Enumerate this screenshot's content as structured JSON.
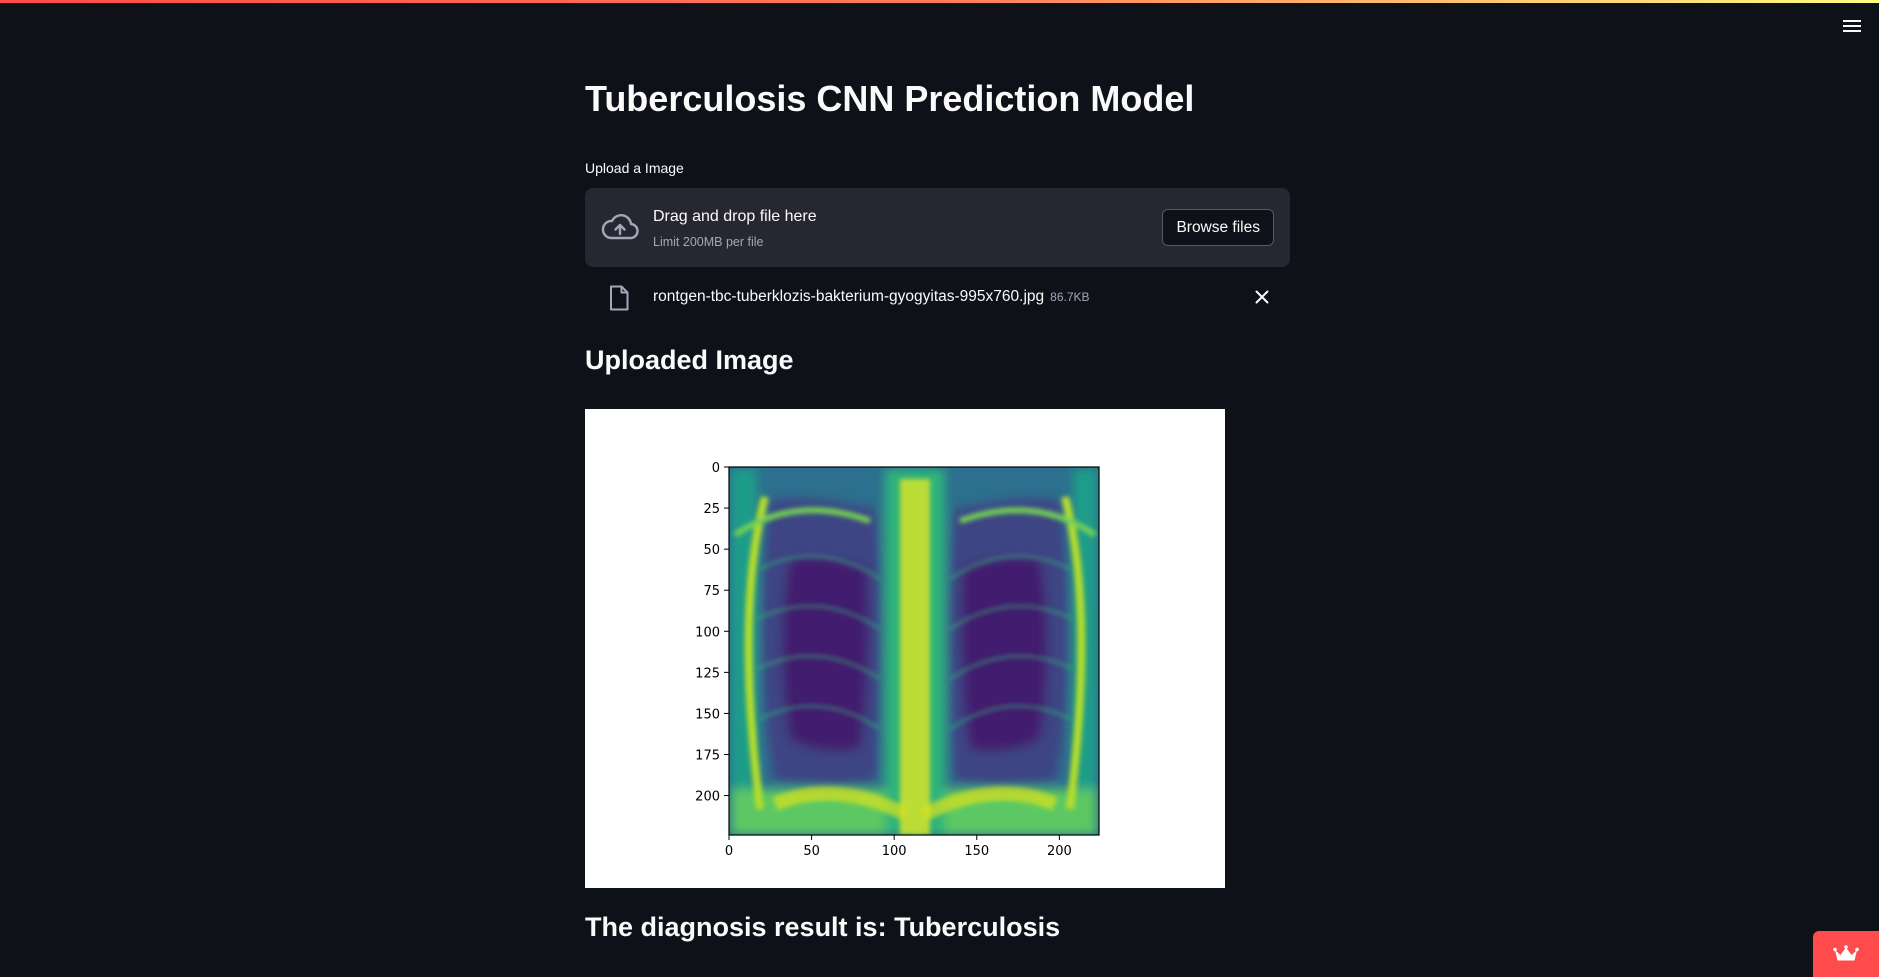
{
  "app": {
    "title": "Tuberculosis CNN Prediction Model",
    "icons": {
      "menu": "hamburger-menu-icon",
      "deploy": "crown-icon"
    }
  },
  "uploader": {
    "label": "Upload a Image",
    "dropzone_title": "Drag and drop file here",
    "dropzone_limit": "Limit 200MB per file",
    "browse_label": "Browse files",
    "icons": {
      "upload": "cloud-upload-icon",
      "file": "file-icon",
      "remove": "close-icon"
    },
    "file": {
      "name": "rontgen-tbc-tuberklozis-bakterium-gyogyitas-995x760.jpg",
      "size": "86.7KB"
    }
  },
  "section_uploaded": {
    "heading": "Uploaded Image"
  },
  "chart_data": {
    "type": "heatmap",
    "title": "",
    "xlabel": "",
    "ylabel": "",
    "image_size": [
      224,
      224
    ],
    "colormap": "viridis",
    "xlim": [
      0,
      224
    ],
    "ylim": [
      224,
      0
    ],
    "x_ticks": [
      0,
      50,
      100,
      150,
      200
    ],
    "y_ticks": [
      0,
      25,
      50,
      75,
      100,
      125,
      150,
      175,
      200
    ],
    "x_tick_labels": [
      "0",
      "50",
      "100",
      "150",
      "200"
    ],
    "y_tick_labels": [
      "0",
      "25",
      "50",
      "75",
      "100",
      "125",
      "150",
      "175",
      "200"
    ],
    "grid": false,
    "colors": {
      "low": "#440154",
      "mid": "#21918c",
      "high": "#fde725"
    }
  },
  "result": {
    "prefix": "The diagnosis result is: ",
    "value": "Tuberculosis"
  },
  "theme": {
    "background": "#0e1117",
    "panel": "#262730",
    "accent": "#ff4b4b"
  }
}
